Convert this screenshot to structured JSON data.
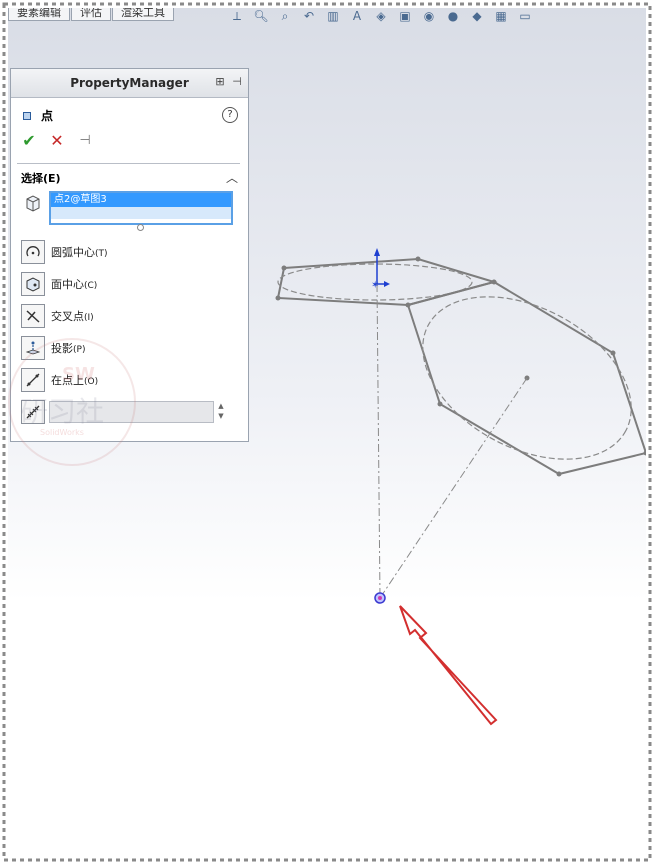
{
  "tabs": [
    "要素编辑",
    "评估",
    "渲染工具"
  ],
  "toolbar_icons": [
    "view-orientation-icon",
    "zoom-fit-icon",
    "zoom-area-icon",
    "previous-view-icon",
    "section-view-icon",
    "dynamic-annotation-icon",
    "view-orientation-cube-icon",
    "display-style-icon",
    "hide-show-icon",
    "edit-appearance-icon",
    "apply-scene-icon",
    "view-settings-icon",
    "monitor-icon"
  ],
  "property_manager": {
    "title": "PropertyManager",
    "feature_name": "点",
    "group_title": "选择(E)",
    "selection_item": "点2@草图3",
    "options": [
      {
        "label": "圆弧中心",
        "key": "(T)",
        "icon": "arc-center-icon"
      },
      {
        "label": "面中心",
        "key": "(C)",
        "icon": "face-center-icon"
      },
      {
        "label": "交叉点",
        "key": "(I)",
        "icon": "intersection-icon"
      },
      {
        "label": "投影",
        "key": "(P)",
        "icon": "projection-icon"
      },
      {
        "label": "在点上",
        "key": "(O)",
        "icon": "on-point-icon"
      }
    ],
    "distribution_value": ""
  },
  "watermark": {
    "badge": "SW",
    "text": "研习社",
    "sub": "SolidWorks"
  },
  "colors": {
    "selection_highlight": "#3399ff",
    "accept": "#2e9a2e",
    "cancel": "#c62828",
    "annotation_arrow": "#d32f2f",
    "sketch_lines": "#7d7d7d",
    "point_marker": "#3a3ad0"
  }
}
